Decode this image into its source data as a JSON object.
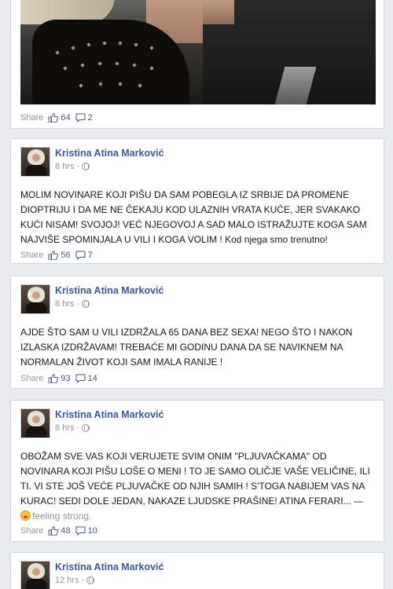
{
  "colors": {
    "background": "#e9ebee",
    "author_link": "#3b5998",
    "meta_text": "#90949c"
  },
  "posts": [
    {
      "share_label": "Share",
      "likes": "64",
      "comments": "2"
    },
    {
      "author": "Kristina Atina Marković",
      "time": "8 hrs",
      "text": "MOLIM NOVINARE KOJI PIŠU DA SAM POBEGLA IZ SRBIJE DA PROMENE DIOPTRIJU I DA ME NE ČEKAJU KOD ULAZNIH VRATA KUĆE, JER SVAKAKO KUĆI NISAM! SVOJOJ! VEĆ NJEGOVOJ A SAD MALO ISTRAŽUJTE KOGA SAM NAJVIŠE SPOMINJALA U VILI I KOGA VOLIM ! Kod njega smo trenutno!",
      "share_label": "Share",
      "likes": "56",
      "comments": "7"
    },
    {
      "author": "Kristina Atina Marković",
      "time": "8 hrs",
      "text": "AJDE ŠTO SAM U VILI IZDRŽALA 65 DANA BEZ SEXA! NEGO ŠTO I NAKON IZLASKA IZDRŽAVAM! TREBAĆE MI GODINU DANA DA SE NAVIKNEM NA NORMALAN ŽIVOT KOJI SAM IMALA RANIJE !",
      "share_label": "Share",
      "likes": "93",
      "comments": "14"
    },
    {
      "author": "Kristina Atina Marković",
      "time": "8 hrs",
      "text": "OBOŽAM SVE VAS KOJI VERUJETE SVIM ONIM \"PLJUVAČKAMA\" OD NOVINARA KOJI PIŠU LOŠE O MENI ! TO JE SAMO OLIČJE VAŠE VELIČINE, ILI TI. VI STE JOŠ VEĆE PLJUVAČKE OD NJIH SAMIH ! S'TOGA NABIJEM VAS NA KURAC! SEDI DOLE JEDAN, NAKAZE LJUDSKE PRAŠINE! ATINA FERARI... —",
      "feeling": "feeling strong.",
      "share_label": "Share",
      "likes": "48",
      "comments": "10"
    },
    {
      "author": "Kristina Atina Marković",
      "time": "12 hrs"
    }
  ]
}
